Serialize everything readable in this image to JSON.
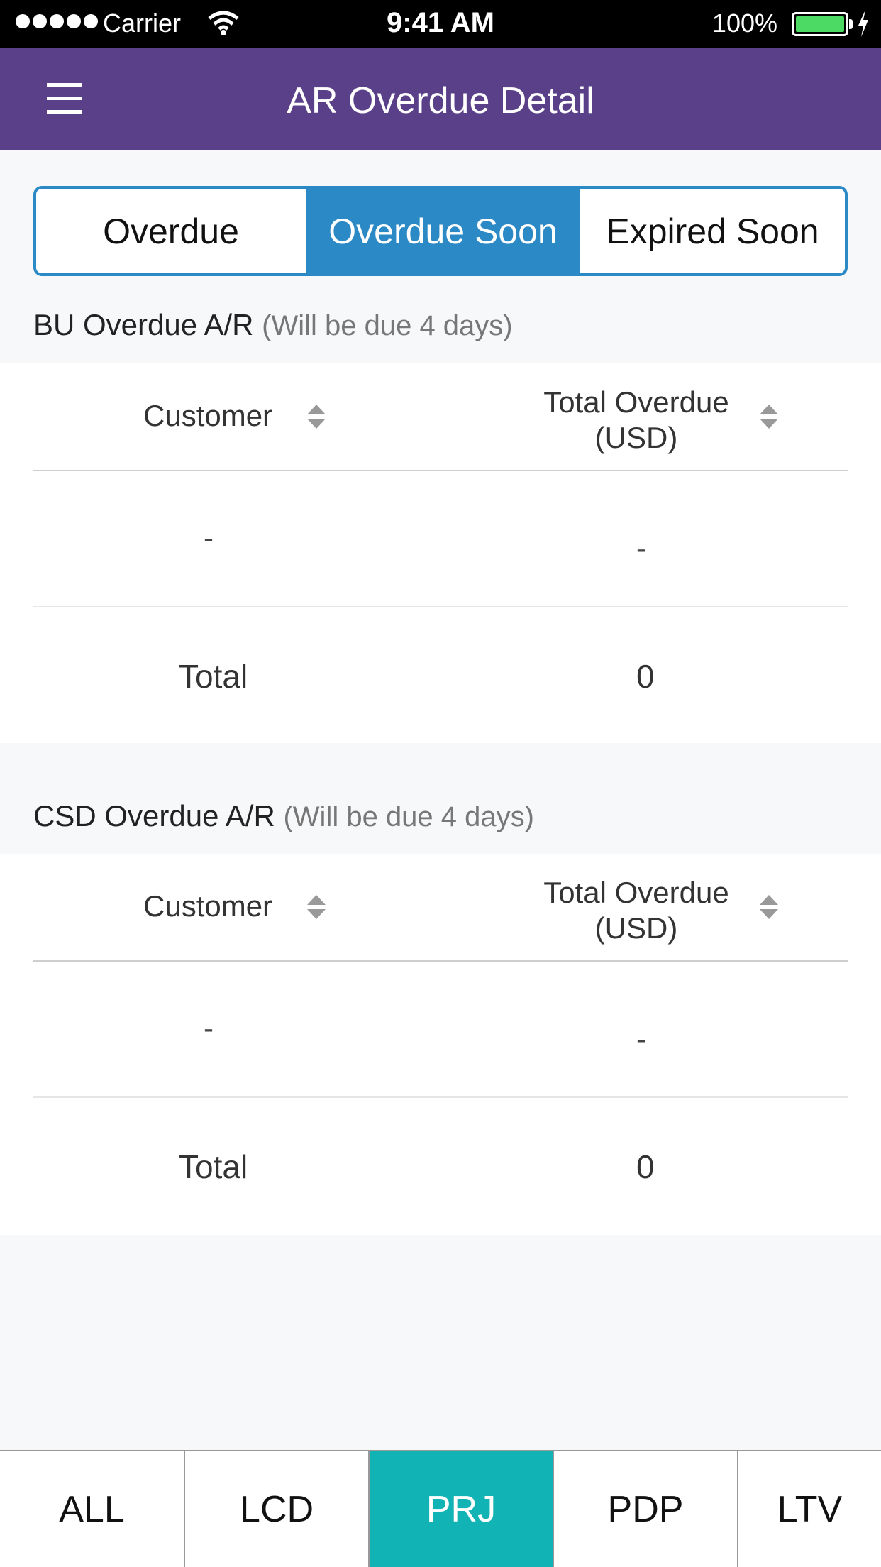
{
  "status_bar": {
    "carrier": "Carrier",
    "time": "9:41 AM",
    "battery": "100%",
    "battery_level": 1.0
  },
  "header": {
    "title": "AR Overdue Detail",
    "menu_icon": "hamburger-menu-icon"
  },
  "segments": {
    "items": [
      "Overdue",
      "Overdue Soon",
      "Expired Soon"
    ],
    "selected": "Overdue Soon"
  },
  "colors": {
    "nav_bar": "#5a4088",
    "segment_accent": "#2b89c5",
    "bottom_tab_active": "#11b3b5"
  },
  "sections": [
    {
      "title": "BU Overdue A/R",
      "subtitle": "(Will be due 4 days)",
      "columns": [
        "Customer",
        "Total Overdue\n(USD)"
      ],
      "rows": [
        [
          "-",
          "-"
        ]
      ],
      "total_label": "Total",
      "total_value": "0"
    },
    {
      "title": "CSD Overdue A/R",
      "subtitle": "(Will be due 4 days)",
      "columns": [
        "Customer",
        "Total Overdue\n(USD)"
      ],
      "rows": [
        [
          "-",
          "-"
        ]
      ],
      "total_label": "Total",
      "total_value": "0"
    }
  ],
  "bottom_tabs": {
    "items": [
      "ALL",
      "LCD",
      "PRJ",
      "PDP",
      "LTV"
    ],
    "selected": "PRJ"
  }
}
